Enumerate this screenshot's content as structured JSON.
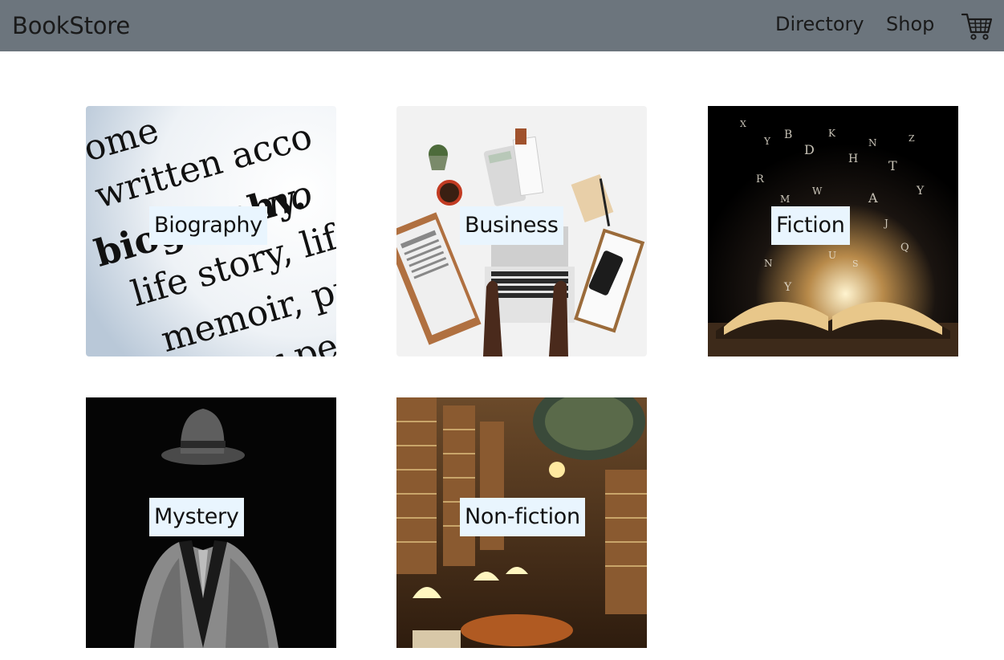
{
  "navbar": {
    "brand": "BookStore",
    "links": [
      {
        "label": "Directory"
      },
      {
        "label": "Shop"
      }
    ],
    "cart_icon": "shopping-cart-icon"
  },
  "categories": [
    {
      "label": "Biography"
    },
    {
      "label": "Business"
    },
    {
      "label": "Fiction"
    },
    {
      "label": "Mystery"
    },
    {
      "label": "Non-fiction"
    }
  ],
  "colors": {
    "navbar_bg": "#6c757d",
    "label_bg": "#e9f5fe",
    "text": "#111111"
  }
}
